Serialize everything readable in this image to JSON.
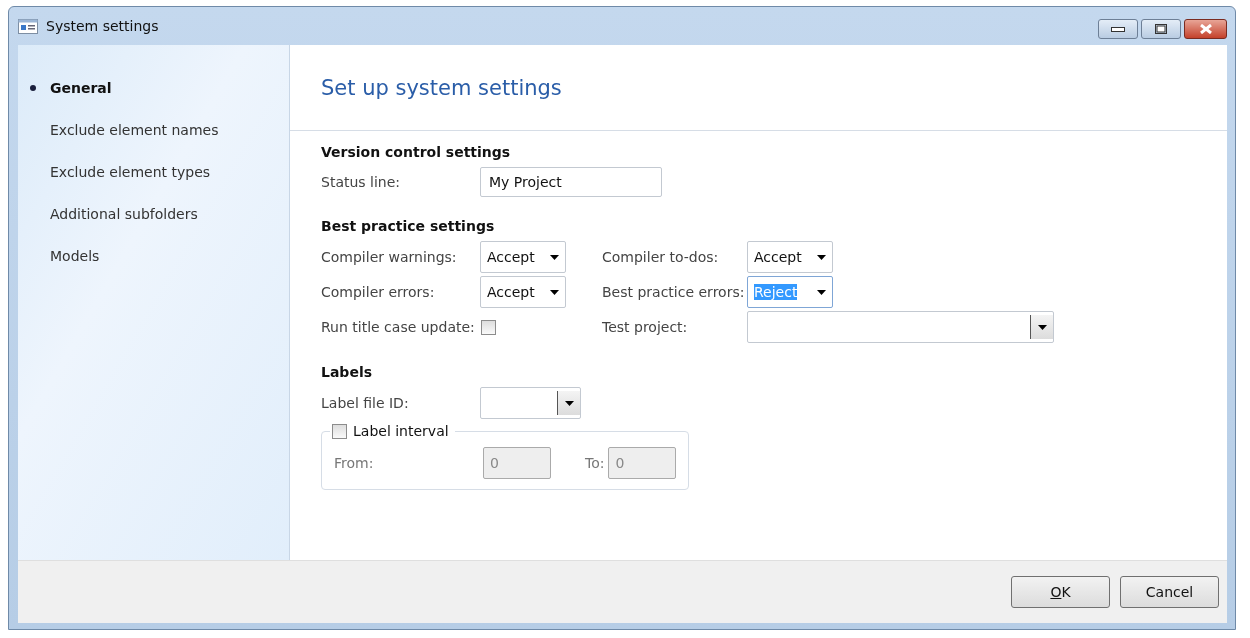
{
  "window": {
    "title": "System settings"
  },
  "sidebar": {
    "items": [
      {
        "label": "General",
        "selected": true
      },
      {
        "label": "Exclude element names",
        "selected": false
      },
      {
        "label": "Exclude element types",
        "selected": false
      },
      {
        "label": "Additional subfolders",
        "selected": false
      },
      {
        "label": "Models",
        "selected": false
      }
    ]
  },
  "heading": "Set up system settings",
  "version_control": {
    "title": "Version control settings",
    "status_line": {
      "label": "Status line:",
      "value": "My Project"
    }
  },
  "best_practice": {
    "title": "Best practice settings",
    "fields": [
      {
        "kind": "dropdown",
        "label": "Compiler warnings:",
        "value": "Accept",
        "text_selected": false
      },
      {
        "kind": "dropdown",
        "label": "Compiler to-dos:",
        "value": "Accept",
        "text_selected": false
      },
      {
        "kind": "dropdown",
        "label": "Compiler errors:",
        "value": "Accept",
        "text_selected": false
      },
      {
        "kind": "dropdown",
        "label": "Best practice errors:",
        "value": "Reject",
        "text_selected": true
      },
      {
        "kind": "checkbox",
        "label": "Run title case update:",
        "checked": false
      },
      {
        "kind": "combo",
        "label": "Test project:"
      }
    ]
  },
  "labels": {
    "title": "Labels",
    "label_file_id": {
      "label": "Label file ID:"
    },
    "label_interval": {
      "label": "Label interval",
      "checked": false,
      "disabled": true,
      "from": {
        "label": "From:",
        "value": "0"
      },
      "to": {
        "label": "To:",
        "value": "0"
      }
    }
  },
  "buttons": [
    {
      "label": "OK",
      "first_letter_underlined": true
    },
    {
      "label": "Cancel"
    }
  ]
}
